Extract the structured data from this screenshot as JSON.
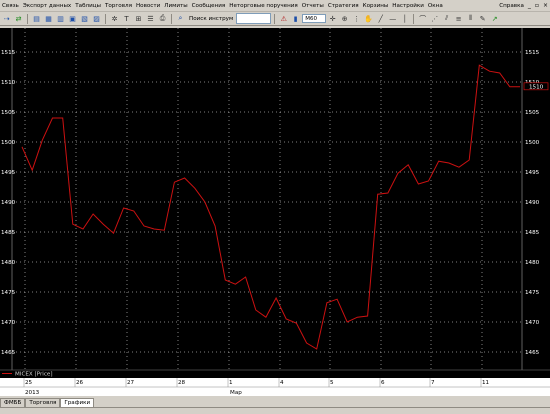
{
  "menu": {
    "items": [
      "Связь",
      "Экспорт данных",
      "Таблицы",
      "Торговля",
      "Новости",
      "Лимиты",
      "Сообщения",
      "Неторговые поручения",
      "Отчеты",
      "Стратегия",
      "Корзины",
      "Настройки",
      "Окна"
    ],
    "help": "Справка",
    "window_controls": [
      "_",
      "▫",
      "×"
    ]
  },
  "toolbar": {
    "search_label": "Поиск инструм",
    "search_value": "",
    "combo_value": "M60"
  },
  "chart_data": {
    "type": "line",
    "title": "",
    "series": [
      {
        "name": "MICEX [Price]",
        "color": "#cc1111",
        "values": [
          1499.2,
          1495.3,
          1500.3,
          1504.0,
          1504.0,
          1486.3,
          1485.5,
          1488.0,
          1486.3,
          1484.8,
          1489.0,
          1488.5,
          1486.0,
          1485.5,
          1485.3,
          1493.3,
          1494.0,
          1492.3,
          1490.0,
          1486.0,
          1477.0,
          1476.3,
          1477.5,
          1472.0,
          1470.8,
          1474.0,
          1470.5,
          1469.8,
          1466.5,
          1465.5,
          1473.2,
          1473.8,
          1470.0,
          1470.8,
          1471.0,
          1491.3,
          1491.5,
          1494.8,
          1496.2,
          1493.0,
          1493.5,
          1496.8,
          1496.5,
          1495.8,
          1497.0,
          1512.8,
          1511.8,
          1511.5,
          1509.2,
          1509.2
        ]
      }
    ],
    "y_ticks": [
      1515,
      1510,
      1505,
      1500,
      1495,
      1490,
      1485,
      1480,
      1475,
      1470,
      1465
    ],
    "ylim": [
      1462,
      1519
    ],
    "last_value": "1510",
    "x_tick_labels": [
      "25",
      "26",
      "27",
      "28",
      "1",
      "2",
      "3",
      "4",
      "5",
      "6",
      "7",
      "11"
    ],
    "x_secondary_labels": [
      "2013",
      "Мар"
    ],
    "grid": true,
    "legend_position": "bottom-left"
  },
  "tabs": [
    "ФМББ",
    "Торговля",
    "Графики"
  ],
  "active_tab": 2,
  "colors": {
    "background": "#000000",
    "line": "#cc1111",
    "grid": "#ffffff",
    "axis_text": "#ffffff"
  }
}
